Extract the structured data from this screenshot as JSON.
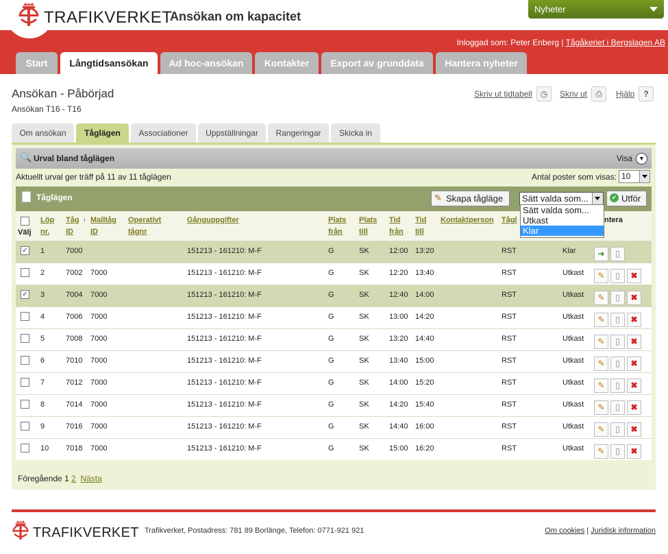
{
  "header": {
    "logo_text": "TRAFIKVERKET",
    "app_title": "Ansökan om kapacitet",
    "news_label": "Nyheter",
    "login_prefix": "Inloggad som: Peter Enberg |",
    "login_link": "Tågåkeriet i Bergslagen AB"
  },
  "main_tabs": [
    "Start",
    "Långtidsansökan",
    "Ad hoc-ansökan",
    "Kontakter",
    "Export av grunddata",
    "Hantera nyheter"
  ],
  "page": {
    "title": "Ansökan - Påbörjad",
    "subtitle": "Ansökan T16 - T16",
    "print_schedule": "Skriv ut tidtabell",
    "print": "Skriv ut",
    "help": "Hjälp",
    "help_icon": "?"
  },
  "sub_tabs": [
    "Om ansökan",
    "Tåglägen",
    "Associationer",
    "Uppställningar",
    "Rangeringar",
    "Skicka in"
  ],
  "filter": {
    "title": "Urval bland tåglägen",
    "show": "Visa",
    "result_text": "Aktuellt urval ger träff på 11 av 11 tåglägen",
    "page_size_label": "Antal poster som visas:",
    "page_size": "10"
  },
  "toolbar": {
    "title": "Tåglägen",
    "create_button": "Skapa tågläge",
    "set_selected": "Sätt valda som...",
    "execute": "Utför",
    "dropdown_options": [
      "Sätt valda som...",
      "Utkast",
      "Klar"
    ]
  },
  "columns": {
    "valj": "Välj",
    "lop": [
      "Löp",
      "nr."
    ],
    "tag": [
      "Tåg",
      "ID"
    ],
    "malltag": [
      "Malltåg",
      "ID"
    ],
    "operativt": [
      "Operativt",
      "tågnr"
    ],
    "ganguppgifter": "Gånguppgifter",
    "plats_fran": [
      "Plats",
      "från"
    ],
    "plats_till": [
      "Plats",
      "till"
    ],
    "tid_fran": [
      "Tid",
      "från"
    ],
    "tid_till": [
      "Tid",
      "till"
    ],
    "kontaktperson": "Kontaktperson",
    "taglage_prefix": "Tågl",
    "hantera_suffix": "ntera"
  },
  "rows": [
    {
      "lop": "1",
      "tag": "7000",
      "malltag": "",
      "gang": "151213 - 161210: M-F",
      "fran": "G",
      "till": "SK",
      "tfran": "12:00",
      "ttill": "13:20",
      "typ": "RST",
      "status": "Klar",
      "checked": "✓"
    },
    {
      "lop": "2",
      "tag": "7002",
      "malltag": "7000",
      "gang": "151213 - 161210: M-F",
      "fran": "G",
      "till": "SK",
      "tfran": "12:20",
      "ttill": "13:40",
      "typ": "RST",
      "status": "Utkast",
      "checked": ""
    },
    {
      "lop": "3",
      "tag": "7004",
      "malltag": "7000",
      "gang": "151213 - 161210: M-F",
      "fran": "G",
      "till": "SK",
      "tfran": "12:40",
      "ttill": "14:00",
      "typ": "RST",
      "status": "Utkast",
      "checked": "✓"
    },
    {
      "lop": "4",
      "tag": "7006",
      "malltag": "7000",
      "gang": "151213 - 161210: M-F",
      "fran": "G",
      "till": "SK",
      "tfran": "13:00",
      "ttill": "14:20",
      "typ": "RST",
      "status": "Utkast",
      "checked": ""
    },
    {
      "lop": "5",
      "tag": "7008",
      "malltag": "7000",
      "gang": "151213 - 161210: M-F",
      "fran": "G",
      "till": "SK",
      "tfran": "13:20",
      "ttill": "14:40",
      "typ": "RST",
      "status": "Utkast",
      "checked": ""
    },
    {
      "lop": "6",
      "tag": "7010",
      "malltag": "7000",
      "gang": "151213 - 161210: M-F",
      "fran": "G",
      "till": "SK",
      "tfran": "13:40",
      "ttill": "15:00",
      "typ": "RST",
      "status": "Utkast",
      "checked": ""
    },
    {
      "lop": "7",
      "tag": "7012",
      "malltag": "7000",
      "gang": "151213 - 161210: M-F",
      "fran": "G",
      "till": "SK",
      "tfran": "14:00",
      "ttill": "15:20",
      "typ": "RST",
      "status": "Utkast",
      "checked": ""
    },
    {
      "lop": "8",
      "tag": "7014",
      "malltag": "7000",
      "gang": "151213 - 161210: M-F",
      "fran": "G",
      "till": "SK",
      "tfran": "14:20",
      "ttill": "15:40",
      "typ": "RST",
      "status": "Utkast",
      "checked": ""
    },
    {
      "lop": "9",
      "tag": "7016",
      "malltag": "7000",
      "gang": "151213 - 161210: M-F",
      "fran": "G",
      "till": "SK",
      "tfran": "14:40",
      "ttill": "16:00",
      "typ": "RST",
      "status": "Utkast",
      "checked": ""
    },
    {
      "lop": "10",
      "tag": "7018",
      "malltag": "7000",
      "gang": "151213 - 161210: M-F",
      "fran": "G",
      "till": "SK",
      "tfran": "15:00",
      "ttill": "16:20",
      "typ": "RST",
      "status": "Utkast",
      "checked": ""
    }
  ],
  "pager": {
    "prev": "Föregående",
    "page1": "1",
    "page2": "2",
    "next": "Nästa"
  },
  "footer": {
    "logo_text": "TRAFIKVERKET",
    "address": "Trafikverket, Postadress: 781 89 Borlänge, Telefon: 0771-921 921",
    "cookies": "Om cookies",
    "legal": "Juridisk information"
  },
  "colors": {
    "brand_red": "#d63a33",
    "accent_green": "#7a9b22",
    "table_header_olive": "#93a16c"
  }
}
